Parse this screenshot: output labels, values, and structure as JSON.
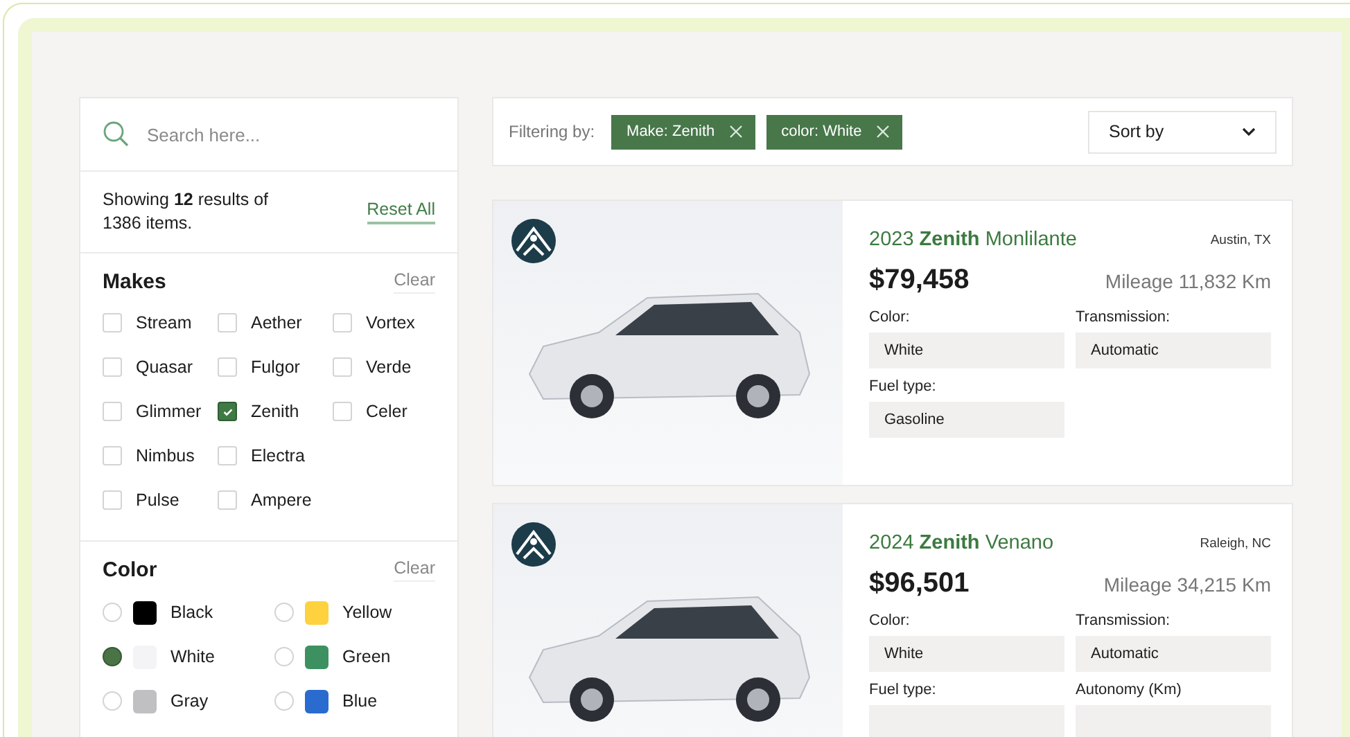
{
  "search": {
    "placeholder": "Search here..."
  },
  "summary": {
    "text": "Showing **12** results of 1386 items.",
    "reset": "Reset All"
  },
  "makes": {
    "title": "Makes",
    "clear": "Clear",
    "rows": [
      [
        {
          "label": "Stream",
          "checked": false
        },
        {
          "label": "Aether",
          "checked": false
        },
        {
          "label": "Vortex",
          "checked": false
        }
      ],
      [
        {
          "label": "Quasar",
          "checked": false
        },
        {
          "label": "Fulgor",
          "checked": false
        },
        {
          "label": "Verde",
          "checked": false
        }
      ],
      [
        {
          "label": "Glimmer",
          "checked": false
        },
        {
          "label": "Zenith",
          "checked": true
        },
        {
          "label": "Celer",
          "checked": false
        }
      ],
      [
        {
          "label": "Nimbus",
          "checked": false
        },
        {
          "label": "Electra",
          "checked": false
        }
      ],
      [
        {
          "label": "Pulse",
          "checked": false
        },
        {
          "label": "Ampere",
          "checked": false
        }
      ]
    ]
  },
  "colors": {
    "title": "Color",
    "clear": "Clear",
    "items": [
      {
        "label": "Black",
        "color": "#000000",
        "selected": false
      },
      {
        "label": "Yellow",
        "color": "#fdd23e",
        "selected": false
      },
      {
        "label": "White",
        "color": "#f4f3f5",
        "selected": true
      },
      {
        "label": "Green",
        "color": "#3d9160",
        "selected": false
      },
      {
        "label": "Gray",
        "color": "#c0bfc1",
        "selected": false
      },
      {
        "label": "Blue",
        "color": "#2a6bd0",
        "selected": false
      }
    ]
  },
  "filter_bar": {
    "label": "Filtering by:",
    "chips": [
      "Make: Zenith",
      "color: White"
    ],
    "sort": "Sort by"
  },
  "listings": [
    {
      "title": "2023 **Zenith** Monlilante",
      "location": "Austin, TX",
      "price": "$79,458",
      "mileage": "Mileage 11,832 Km",
      "specs": [
        {
          "label": "Color:",
          "value": "White"
        },
        {
          "label": "Transmission:",
          "value": "Automatic"
        },
        {
          "label": "Fuel type:",
          "value": "Gasoline"
        }
      ]
    },
    {
      "title": "2024 **Zenith** Venano",
      "location": "Raleigh, NC",
      "price": "$96,501",
      "mileage": "Mileage 34,215 Km",
      "specs": [
        {
          "label": "Color:",
          "value": "White"
        },
        {
          "label": "Transmission:",
          "value": "Automatic"
        },
        {
          "label": "Fuel type:"
        },
        {
          "label": "Autonomy (Km)"
        }
      ]
    }
  ]
}
